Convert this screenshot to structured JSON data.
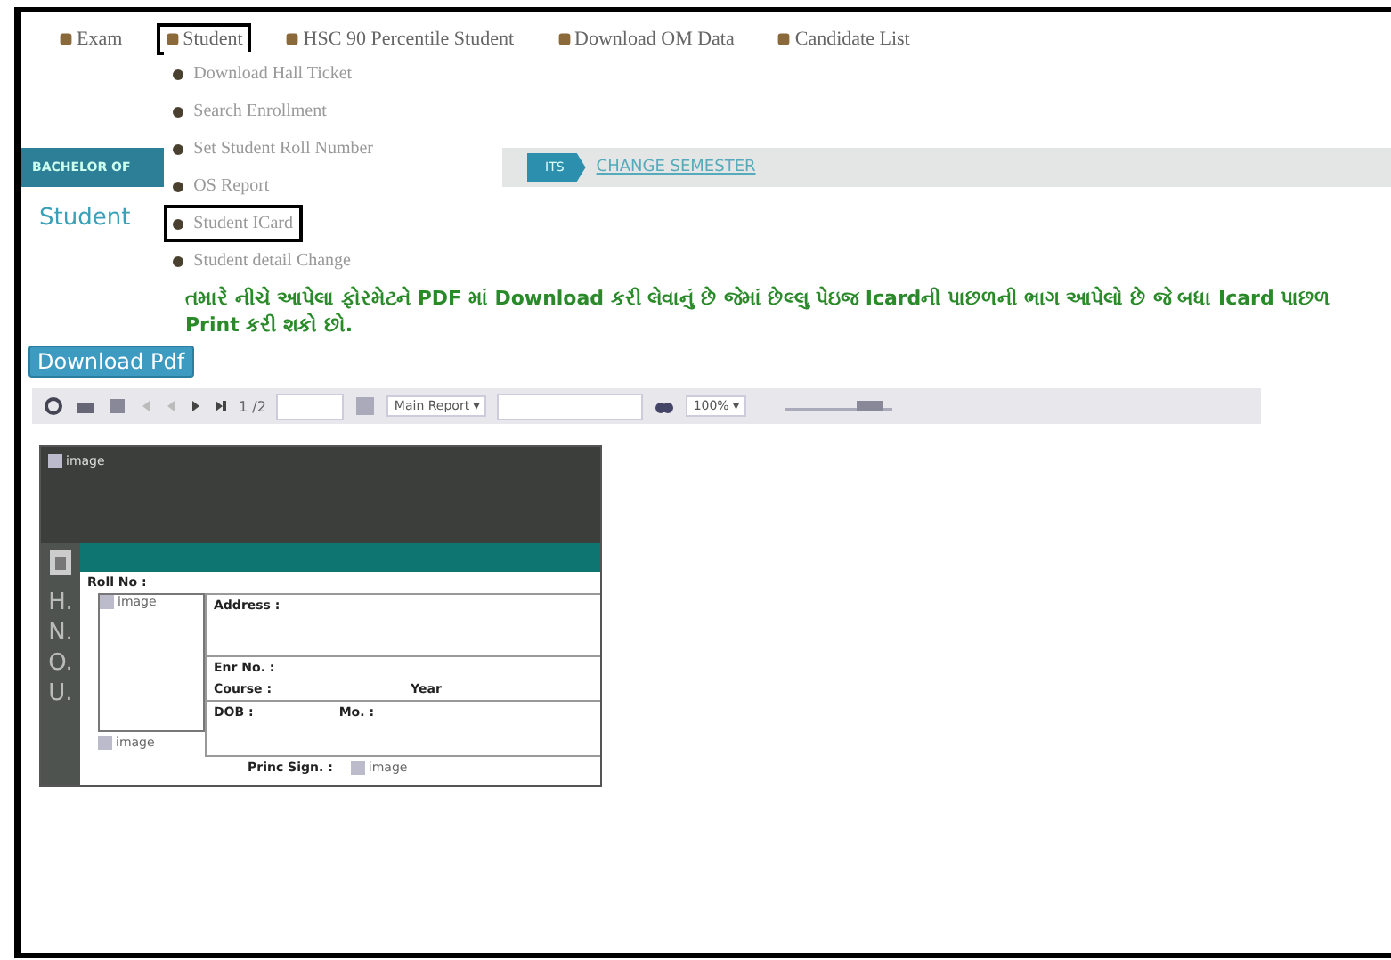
{
  "menu": [
    {
      "label": "Exam",
      "selected": false
    },
    {
      "label": "Student",
      "selected": true
    },
    {
      "label": "HSC 90 Percentile Student",
      "selected": false
    },
    {
      "label": "Download OM Data",
      "selected": false
    },
    {
      "label": "Candidate List",
      "selected": false
    }
  ],
  "dropdown": [
    {
      "label": "Download Hall Ticket",
      "selected": false
    },
    {
      "label": "Search Enrollment",
      "selected": false
    },
    {
      "label": "Set Student Roll Number",
      "selected": false
    },
    {
      "label": "OS Report",
      "selected": false
    },
    {
      "label": "Student ICard",
      "selected": true
    },
    {
      "label": "Student detail Change",
      "selected": false
    }
  ],
  "banner": {
    "program_tab": "BACHELOR OF",
    "step_tab": "ITS",
    "link": "CHANGE SEMESTER"
  },
  "section_title": "Student",
  "instruction": "તમારે નીચે આપેલા ફોરમેટને **PDF** માં **Download** કરી લેવાનું છે જેમાં છેલ્લુ પેઇજ **Icard**ની પાછળની ભાગ આપેલો છે જે બધા **Icard** પાછળ **Print** કરી શકો છો.",
  "download_button": "Download Pdf",
  "viewer_toolbar": {
    "page": "1 /2",
    "report_select": "Main Report ▾",
    "zoom_select": "100% ▾"
  },
  "icard": {
    "header_image": "image",
    "strip_letters": [
      "H.",
      "N.",
      "O.",
      "U."
    ],
    "roll_label": "Roll No :",
    "photo_alt": "image",
    "address_label": "Address :",
    "enr_label": "Enr No. :",
    "course_label": "Course :",
    "year_label": "Year",
    "dob_label": "DOB :",
    "mo_label": "Mo. :",
    "sign_image": "image",
    "princ_label": "Princ Sign. :",
    "princ_image": "image"
  }
}
